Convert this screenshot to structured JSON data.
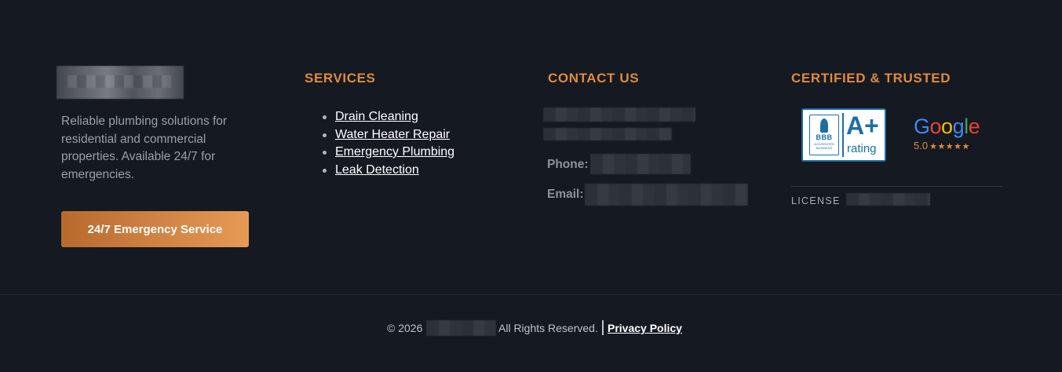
{
  "brand": {
    "tagline": "Reliable plumbing solutions for residential and commercial properties. Available 24/7 for emergencies.",
    "cta_label": "24/7 Emergency Service"
  },
  "services": {
    "heading": "SERVICES",
    "items": [
      {
        "label": "Drain Cleaning"
      },
      {
        "label": "Water Heater Repair"
      },
      {
        "label": "Emergency Plumbing"
      },
      {
        "label": "Leak Detection"
      }
    ]
  },
  "contact": {
    "heading": "CONTACT US",
    "phone_label": "Phone:",
    "email_label": "Email:"
  },
  "certified": {
    "heading": "CERTIFIED & TRUSTED",
    "bbb": {
      "seal_text": "BBB",
      "seal_small": "ACCREDITED BUSINESS",
      "grade": "A+",
      "rating_word": "rating",
      "brand_color": "#1d6fa3"
    },
    "google": {
      "letters": [
        {
          "char": "G",
          "color": "#4285F4"
        },
        {
          "char": "o",
          "color": "#EA4335"
        },
        {
          "char": "o",
          "color": "#FBBC05"
        },
        {
          "char": "g",
          "color": "#4285F4"
        },
        {
          "char": "l",
          "color": "#34A853"
        },
        {
          "char": "e",
          "color": "#EA4335"
        }
      ],
      "score": "5.0",
      "stars": "★★★★★"
    },
    "license_label": "LICENSE"
  },
  "bottom": {
    "copyright": "© 2026",
    "rights": "All Rights Reserved.",
    "privacy": "Privacy Policy"
  },
  "colors": {
    "background": "#141922",
    "accent": "#e08a3c",
    "button_gradient_start": "#b86a2e",
    "button_gradient_end": "#e69a55"
  }
}
